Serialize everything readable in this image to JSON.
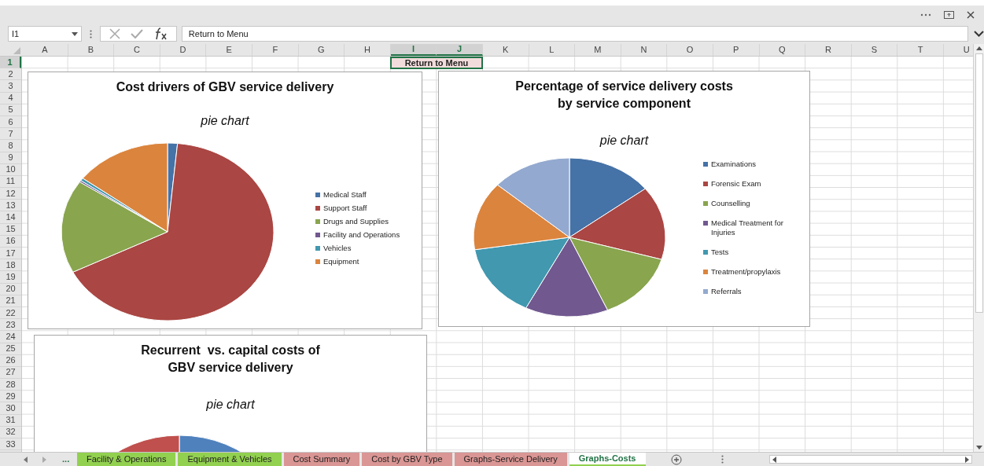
{
  "name_box": "I1",
  "formula": "Return to Menu",
  "columns": [
    {
      "label": "A",
      "selected": false
    },
    {
      "label": "B",
      "selected": false
    },
    {
      "label": "C",
      "selected": false
    },
    {
      "label": "D",
      "selected": false
    },
    {
      "label": "E",
      "selected": false
    },
    {
      "label": "F",
      "selected": false
    },
    {
      "label": "G",
      "selected": false
    },
    {
      "label": "H",
      "selected": false
    },
    {
      "label": "I",
      "selected": true
    },
    {
      "label": "J",
      "selected": true
    },
    {
      "label": "K",
      "selected": false
    },
    {
      "label": "L",
      "selected": false
    },
    {
      "label": "M",
      "selected": false
    },
    {
      "label": "N",
      "selected": false
    },
    {
      "label": "O",
      "selected": false
    },
    {
      "label": "P",
      "selected": false
    },
    {
      "label": "Q",
      "selected": false
    },
    {
      "label": "R",
      "selected": false
    },
    {
      "label": "S",
      "selected": false
    },
    {
      "label": "T",
      "selected": false
    },
    {
      "label": "U",
      "selected": false
    }
  ],
  "rows": [
    {
      "label": "1",
      "selected": true
    },
    {
      "label": "2",
      "selected": false
    },
    {
      "label": "3",
      "selected": false
    },
    {
      "label": "4",
      "selected": false
    },
    {
      "label": "5",
      "selected": false
    },
    {
      "label": "6",
      "selected": false
    },
    {
      "label": "7",
      "selected": false
    },
    {
      "label": "8",
      "selected": false
    },
    {
      "label": "9",
      "selected": false
    },
    {
      "label": "10",
      "selected": false
    },
    {
      "label": "11",
      "selected": false
    },
    {
      "label": "12",
      "selected": false
    },
    {
      "label": "13",
      "selected": false
    },
    {
      "label": "14",
      "selected": false
    },
    {
      "label": "15",
      "selected": false
    },
    {
      "label": "16",
      "selected": false
    },
    {
      "label": "17",
      "selected": false
    },
    {
      "label": "18",
      "selected": false
    },
    {
      "label": "19",
      "selected": false
    },
    {
      "label": "20",
      "selected": false
    },
    {
      "label": "21",
      "selected": false
    },
    {
      "label": "22",
      "selected": false
    },
    {
      "label": "23",
      "selected": false
    },
    {
      "label": "24",
      "selected": false
    },
    {
      "label": "25",
      "selected": false
    },
    {
      "label": "26",
      "selected": false
    },
    {
      "label": "27",
      "selected": false
    },
    {
      "label": "28",
      "selected": false
    },
    {
      "label": "29",
      "selected": false
    },
    {
      "label": "30",
      "selected": false
    },
    {
      "label": "31",
      "selected": false
    },
    {
      "label": "32",
      "selected": false
    },
    {
      "label": "33",
      "selected": false
    }
  ],
  "menu_cell": {
    "text": "Return to Menu",
    "selected": true
  },
  "charts": [
    {
      "title": [
        "Cost drivers of GBV service delivery"
      ],
      "subtitle": "pie chart",
      "legend": [
        {
          "label": "Medical Staff",
          "color": "#4572a7"
        },
        {
          "label": "Support Staff",
          "color": "#aa4643"
        },
        {
          "label": "Drugs and Supplies",
          "color": "#89a54e"
        },
        {
          "label": "Facility and Operations",
          "color": "#71588f"
        },
        {
          "label": "Vehicles",
          "color": "#4198af"
        },
        {
          "label": "Equipment",
          "color": "#db843d"
        }
      ]
    },
    {
      "title": [
        "Percentage of service delivery costs",
        "by service component"
      ],
      "subtitle": "pie chart",
      "legend": [
        {
          "label": "Examinations",
          "color": "#4572a7"
        },
        {
          "label": "Forensic Exam",
          "color": "#aa4643"
        },
        {
          "label": "Counselling",
          "color": "#89a54e"
        },
        {
          "label": "Medical Treatment for Injuries",
          "color": "#71588f"
        },
        {
          "label": "Tests",
          "color": "#4198af"
        },
        {
          "label": "Treatment/propylaxis",
          "color": "#db843d"
        },
        {
          "label": "Referrals",
          "color": "#93a9cf"
        }
      ]
    },
    {
      "title": [
        "Recurrent  vs. capital costs of",
        "GBV service delivery"
      ],
      "subtitle": "pie chart"
    }
  ],
  "more_tabs": "...",
  "sheet_tabs": [
    {
      "label": "Facility & Operations",
      "color": "#92d050",
      "selected": false
    },
    {
      "label": "Equipment & Vehicles",
      "color": "#92d050",
      "selected": false
    },
    {
      "label": "Cost Summary",
      "color": "#da9694",
      "selected": false
    },
    {
      "label": "Cost by GBV Type",
      "color": "#da9694",
      "selected": false
    },
    {
      "label": "Graphs-Service Delivery",
      "color": "#da9694",
      "selected": false
    },
    {
      "label": "Graphs-Costs",
      "color": "#92d050",
      "selected": true
    }
  ]
}
